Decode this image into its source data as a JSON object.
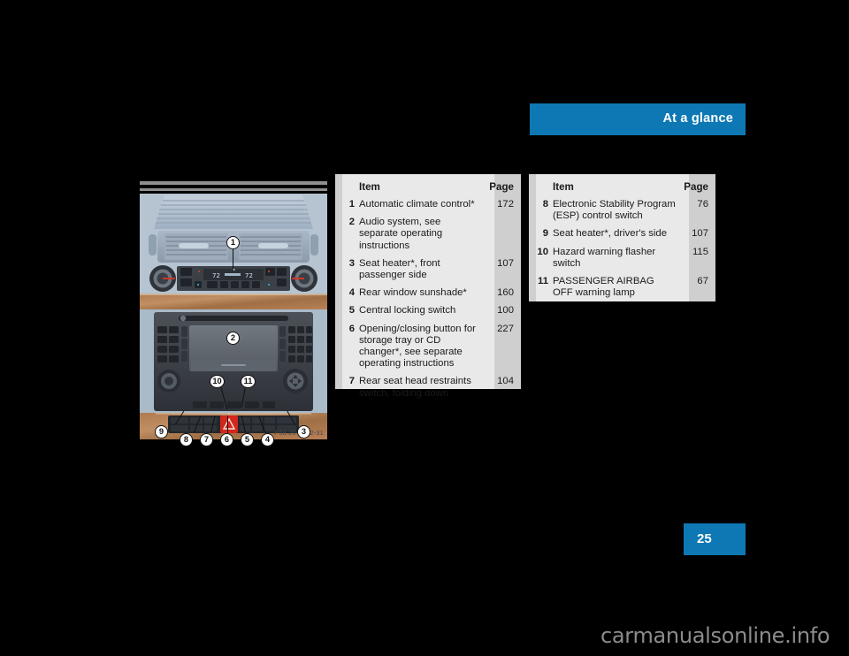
{
  "header": {
    "title": "At a glance",
    "accent_color": "#0d78b4"
  },
  "page_number": "25",
  "watermark": "carmanualsonline.info",
  "figure": {
    "caption": "P68.20-2642-31",
    "alt_name": "center-console-illustration",
    "callouts": [
      "1",
      "2",
      "3",
      "4",
      "5",
      "6",
      "7",
      "8",
      "9",
      "10",
      "11"
    ],
    "display_text_left": "72",
    "display_text_right": "72"
  },
  "tables": [
    {
      "id": "left",
      "headers": {
        "item": "Item",
        "page": "Page"
      },
      "rows": [
        {
          "num": "1",
          "item": "Automatic climate control*",
          "page": "172"
        },
        {
          "num": "2",
          "item": "Audio system, see separate operating instructions",
          "page": ""
        },
        {
          "num": "3",
          "item": "Seat heater*, front passenger side",
          "page": "107"
        },
        {
          "num": "4",
          "item": "Rear window sunshade*",
          "page": "160"
        },
        {
          "num": "5",
          "item": "Central locking switch",
          "page": "100"
        },
        {
          "num": "6",
          "item": "Opening/closing button for storage tray or CD changer*, see separate operating instructions",
          "page": "227"
        },
        {
          "num": "7",
          "item": "Rear seat head restraints switch, folding down",
          "page": "104"
        }
      ]
    },
    {
      "id": "right",
      "headers": {
        "item": "Item",
        "page": "Page"
      },
      "rows": [
        {
          "num": "8",
          "item": "Electronic Stability Program (ESP) control switch",
          "page": "76"
        },
        {
          "num": "9",
          "item": "Seat heater*, driver's side",
          "page": "107"
        },
        {
          "num": "10",
          "item": "Hazard warning flasher switch",
          "page": "115"
        },
        {
          "num": "11",
          "item": "PASSENGER AIRBAG OFF warning lamp",
          "page": "67"
        }
      ]
    }
  ]
}
